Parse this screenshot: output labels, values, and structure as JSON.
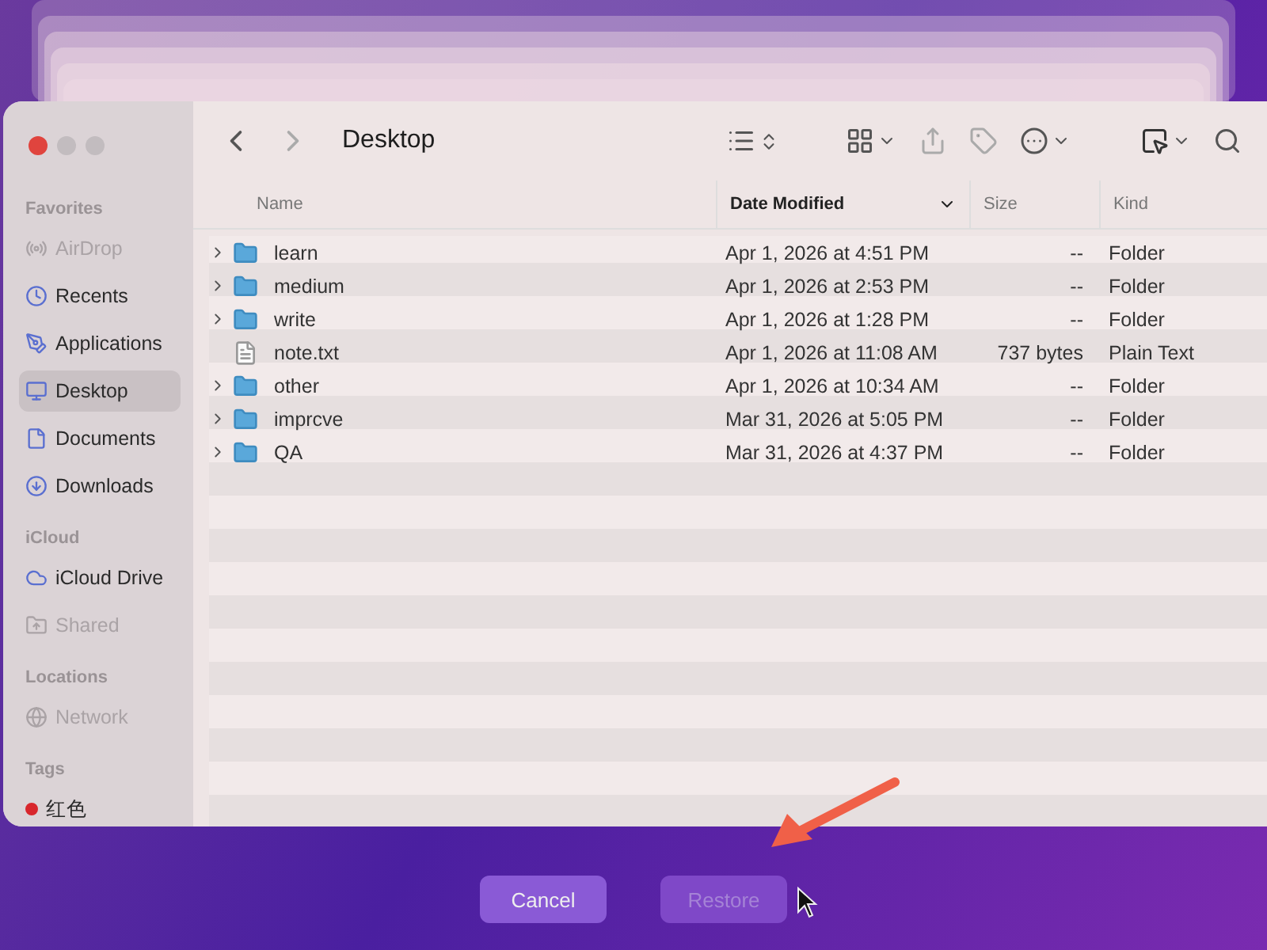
{
  "window": {
    "title": "Desktop"
  },
  "sidebar": [
    {
      "heading": "Favorites",
      "items": [
        {
          "label": "AirDrop",
          "selected": false,
          "disabled": true
        },
        {
          "label": "Recents",
          "selected": false,
          "disabled": false
        },
        {
          "label": "Applications",
          "selected": false,
          "disabled": false
        },
        {
          "label": "Desktop",
          "selected": true,
          "disabled": false
        },
        {
          "label": "Documents",
          "selected": false,
          "disabled": false
        },
        {
          "label": "Downloads",
          "selected": false,
          "disabled": false
        }
      ]
    },
    {
      "heading": "iCloud",
      "items": [
        {
          "label": "iCloud Drive",
          "selected": false,
          "disabled": false
        },
        {
          "label": "Shared",
          "selected": false,
          "disabled": true
        }
      ]
    },
    {
      "heading": "Locations",
      "items": [
        {
          "label": "Network",
          "selected": false,
          "disabled": true
        }
      ]
    },
    {
      "heading": "Tags"
    }
  ],
  "tags": [
    {
      "label": "红色",
      "color": "#d8262c"
    }
  ],
  "columns": [
    {
      "label": "Name",
      "selected": false
    },
    {
      "label": "Date Modified",
      "selected": true
    },
    {
      "label": "Size",
      "selected": false
    },
    {
      "label": "Kind",
      "selected": false
    }
  ],
  "rows": [
    {
      "kind": "folder",
      "name": "learn",
      "date": "Apr 1, 2026 at 4:51 PM",
      "size": "--",
      "type": "Folder"
    },
    {
      "kind": "folder",
      "name": "medium",
      "date": "Apr 1, 2026 at 2:53 PM",
      "size": "--",
      "type": "Folder"
    },
    {
      "kind": "folder",
      "name": "write",
      "date": "Apr 1, 2026 at 1:28 PM",
      "size": "--",
      "type": "Folder"
    },
    {
      "kind": "file",
      "name": "note.txt",
      "date": "Apr 1, 2026 at 11:08 AM",
      "size": "737 bytes",
      "type": "Plain Text"
    },
    {
      "kind": "folder",
      "name": "other",
      "date": "Apr 1, 2026 at 10:34 AM",
      "size": "--",
      "type": "Folder"
    },
    {
      "kind": "folder",
      "name": "imprcve",
      "date": "Mar 31, 2026 at 5:05 PM",
      "size": "--",
      "type": "Folder"
    },
    {
      "kind": "folder",
      "name": "QA",
      "date": "Mar 31, 2026 at 4:37 PM",
      "size": "--",
      "type": "Folder"
    }
  ],
  "buttons": [
    {
      "label": "Cancel",
      "disabled": false
    },
    {
      "label": "Restore",
      "disabled": true
    }
  ]
}
